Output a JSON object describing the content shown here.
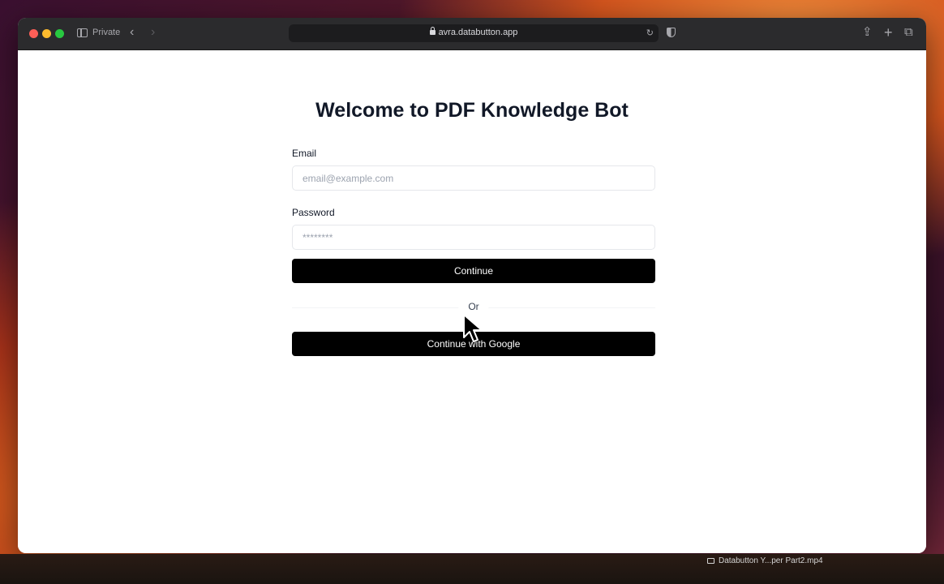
{
  "browser": {
    "mode_label": "Private",
    "url": "avra.databutton.app"
  },
  "page": {
    "title": "Welcome to PDF Knowledge Bot"
  },
  "form": {
    "email_label": "Email",
    "email_placeholder": "email@example.com",
    "password_label": "Password",
    "password_placeholder": "********",
    "continue_label": "Continue",
    "divider_text": "Or",
    "google_label": "Continue with Google"
  },
  "desktop": {
    "file_label": "Databutton Y...per Part2.mp4"
  }
}
